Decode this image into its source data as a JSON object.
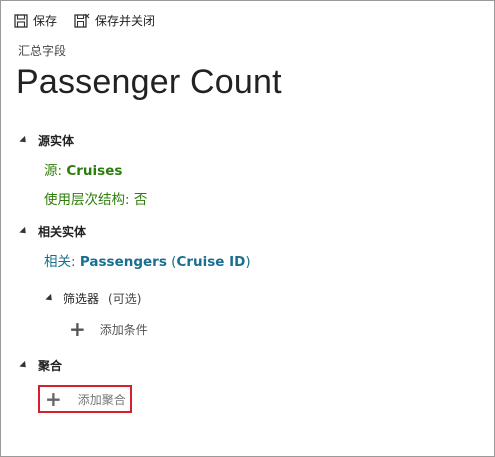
{
  "toolbar": {
    "save_label": "保存",
    "save_close_label": "保存并关闭",
    "save_icon": "save-icon",
    "save_close_icon": "save-close-icon"
  },
  "header": {
    "subtitle": "汇总字段",
    "title": "Passenger Count"
  },
  "source_section": {
    "heading": "源实体",
    "source_label": "源:",
    "source_value": "Cruises",
    "hierarchy_label": "使用层次结构:",
    "hierarchy_value": "否"
  },
  "related_section": {
    "heading": "相关实体",
    "related_label": "相关:",
    "related_entity": "Passengers",
    "related_key_open": "(",
    "related_key": "Cruise ID",
    "related_key_close": ")",
    "filter_heading": "筛选器",
    "filter_optional": "(可选)",
    "add_condition_label": "添加条件"
  },
  "aggregate_section": {
    "heading": "聚合",
    "add_aggregate_label": "添加聚合"
  },
  "colors": {
    "green_text": "#2e7d0a",
    "blue_text": "#1a6f90",
    "highlight_border": "#d6202a"
  }
}
